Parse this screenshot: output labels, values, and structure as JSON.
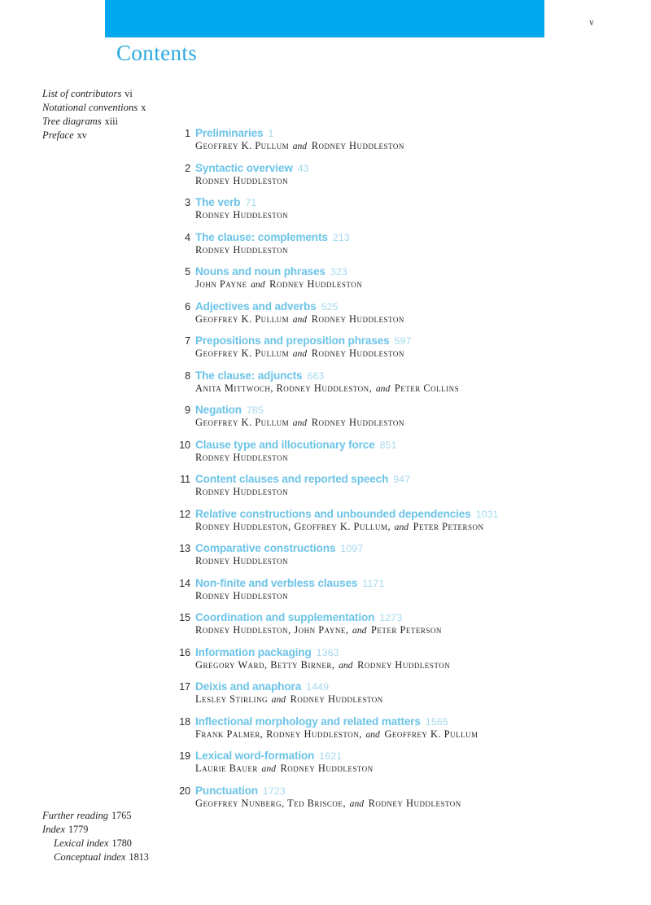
{
  "folio": "v",
  "page_title": "Contents",
  "accent_bar_color": "#03a9ee",
  "title_color": "#2aaae1",
  "chapter_title_color": "#6cc4e8",
  "chapter_page_color": "#a4d9ee",
  "front_matter": [
    {
      "label": "List of contributors",
      "page": "vi",
      "indent": false
    },
    {
      "label": "Notational conventions",
      "page": "x",
      "indent": false
    },
    {
      "label": "Tree diagrams",
      "page": "xiii",
      "indent": false
    },
    {
      "label": "Preface",
      "page": "xv",
      "indent": false
    }
  ],
  "back_matter": [
    {
      "label": "Further reading",
      "page": "1765",
      "indent": false
    },
    {
      "label": "Index",
      "page": "1779",
      "indent": false
    },
    {
      "label": "Lexical index",
      "page": "1780",
      "indent": true
    },
    {
      "label": "Conceptual index",
      "page": "1813",
      "indent": true
    }
  ],
  "chapters": [
    {
      "number": "1",
      "title": "Preliminaries",
      "page": "1",
      "authors": [
        "Geoffrey K. Pullum",
        "Rodney Huddleston"
      ],
      "author_line": "Geoffrey K. Pullum and Rodney Huddleston",
      "conjunction": "and",
      "oxford_comma": false
    },
    {
      "number": "2",
      "title": "Syntactic overview",
      "page": "43",
      "authors": [
        "Rodney Huddleston"
      ],
      "author_line": "Rodney Huddleston",
      "conjunction": "",
      "oxford_comma": false
    },
    {
      "number": "3",
      "title": "The verb",
      "page": "71",
      "authors": [
        "Rodney Huddleston"
      ],
      "author_line": "Rodney Huddleston",
      "conjunction": "",
      "oxford_comma": false
    },
    {
      "number": "4",
      "title": "The clause: complements",
      "page": "213",
      "authors": [
        "Rodney Huddleston"
      ],
      "author_line": "Rodney Huddleston",
      "conjunction": "",
      "oxford_comma": false
    },
    {
      "number": "5",
      "title": "Nouns and noun phrases",
      "page": "323",
      "authors": [
        "John Payne",
        "Rodney Huddleston"
      ],
      "author_line": "John Payne and Rodney Huddleston",
      "conjunction": "and",
      "oxford_comma": false
    },
    {
      "number": "6",
      "title": "Adjectives and adverbs",
      "page": "525",
      "authors": [
        "Geoffrey K. Pullum",
        "Rodney Huddleston"
      ],
      "author_line": "Geoffrey K. Pullum and Rodney Huddleston",
      "conjunction": "and",
      "oxford_comma": false
    },
    {
      "number": "7",
      "title": "Prepositions and preposition phrases",
      "page": "597",
      "authors": [
        "Geoffrey K. Pullum",
        "Rodney Huddleston"
      ],
      "author_line": "Geoffrey K. Pullum and Rodney Huddleston",
      "conjunction": "and",
      "oxford_comma": false
    },
    {
      "number": "8",
      "title": "The clause: adjuncts",
      "page": "663",
      "authors": [
        "Anita Mittwoch",
        "Rodney Huddleston",
        "Peter Collins"
      ],
      "author_line": "Anita Mittwoch, Rodney Huddleston, and Peter Collins",
      "conjunction": "and",
      "oxford_comma": true
    },
    {
      "number": "9",
      "title": "Negation",
      "page": "785",
      "authors": [
        "Geoffrey K. Pullum",
        "Rodney Huddleston"
      ],
      "author_line": "Geoffrey K. Pullum and Rodney Huddleston",
      "conjunction": "and",
      "oxford_comma": false
    },
    {
      "number": "10",
      "title": "Clause type and illocutionary force",
      "page": "851",
      "authors": [
        "Rodney Huddleston"
      ],
      "author_line": "Rodney Huddleston",
      "conjunction": "",
      "oxford_comma": false
    },
    {
      "number": "11",
      "title": "Content clauses and reported speech",
      "page": "947",
      "authors": [
        "Rodney Huddleston"
      ],
      "author_line": "Rodney Huddleston",
      "conjunction": "",
      "oxford_comma": false
    },
    {
      "number": "12",
      "title": "Relative constructions and unbounded dependencies",
      "page": "1031",
      "authors": [
        "Rodney Huddleston",
        "Geoffrey K. Pullum",
        "Peter Peterson"
      ],
      "author_line": "Rodney Huddleston, Geoffrey K. Pullum, and Peter Peterson",
      "conjunction": "and",
      "oxford_comma": true
    },
    {
      "number": "13",
      "title": "Comparative constructions",
      "page": "1097",
      "authors": [
        "Rodney Huddleston"
      ],
      "author_line": "Rodney Huddleston",
      "conjunction": "",
      "oxford_comma": false
    },
    {
      "number": "14",
      "title": "Non-finite and verbless clauses",
      "page": "1171",
      "authors": [
        "Rodney Huddleston"
      ],
      "author_line": "Rodney Huddleston",
      "conjunction": "",
      "oxford_comma": false
    },
    {
      "number": "15",
      "title": "Coordination and supplementation",
      "page": "1273",
      "authors": [
        "Rodney Huddleston",
        "John Payne",
        "Peter Peterson"
      ],
      "author_line": "Rodney Huddleston, John Payne, and Peter Peterson",
      "conjunction": "and",
      "oxford_comma": true
    },
    {
      "number": "16",
      "title": "Information packaging",
      "page": "1363",
      "authors": [
        "Gregory Ward",
        "Betty Birner",
        "Rodney Huddleston"
      ],
      "author_line": "Gregory Ward, Betty Birner, and Rodney Huddleston",
      "conjunction": "and",
      "oxford_comma": true
    },
    {
      "number": "17",
      "title": "Deixis and anaphora",
      "page": "1449",
      "authors": [
        "Lesley Stirling",
        "Rodney Huddleston"
      ],
      "author_line": "Lesley Stirling and Rodney Huddleston",
      "conjunction": "and",
      "oxford_comma": false
    },
    {
      "number": "18",
      "title": "Inflectional morphology and related matters",
      "page": "1565",
      "authors": [
        "Frank Palmer",
        "Rodney Huddleston",
        "Geoffrey K. Pullum"
      ],
      "author_line": "Frank Palmer, Rodney Huddleston, and Geoffrey K. Pullum",
      "conjunction": "and",
      "oxford_comma": true
    },
    {
      "number": "19",
      "title": "Lexical word-formation",
      "page": "1621",
      "authors": [
        "Laurie Bauer",
        "Rodney Huddleston"
      ],
      "author_line": "Laurie Bauer and Rodney Huddleston",
      "conjunction": "and",
      "oxford_comma": false
    },
    {
      "number": "20",
      "title": "Punctuation",
      "page": "1723",
      "authors": [
        "Geoffrey Nunberg",
        "Ted Briscoe",
        "Rodney Huddleston"
      ],
      "author_line": "Geoffrey Nunberg, Ted Briscoe, and Rodney Huddleston",
      "conjunction": "and",
      "oxford_comma": true
    }
  ]
}
